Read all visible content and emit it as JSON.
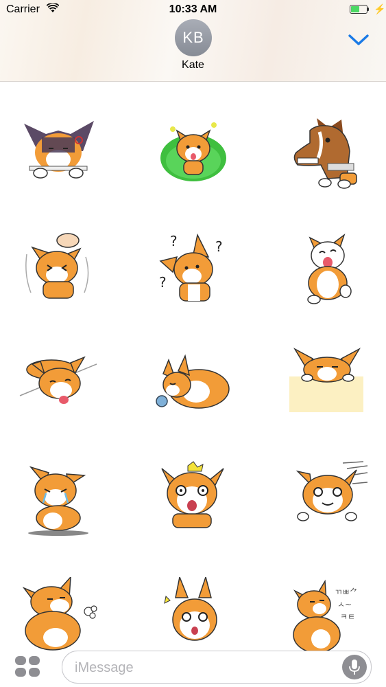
{
  "status_bar": {
    "carrier": "Carrier",
    "time": "10:33 AM",
    "battery_level": 0.55
  },
  "header": {
    "avatar_initials": "KB",
    "contact_name": "Kate",
    "chevron_icon": "chevron-down-icon"
  },
  "stickers": [
    {
      "name": "sticker-corgi-gloomy"
    },
    {
      "name": "sticker-corgi-in-grass"
    },
    {
      "name": "sticker-corgi-horse-mask"
    },
    {
      "name": "sticker-corgi-head-pat"
    },
    {
      "name": "sticker-corgi-confused"
    },
    {
      "name": "sticker-corgi-laughing"
    },
    {
      "name": "sticker-corgi-lying-tongue-out"
    },
    {
      "name": "sticker-corgi-sleeping"
    },
    {
      "name": "sticker-corgi-peeking-over-sign"
    },
    {
      "name": "sticker-corgi-crying"
    },
    {
      "name": "sticker-corgi-shocked"
    },
    {
      "name": "sticker-corgi-dashing"
    },
    {
      "name": "sticker-corgi-huffing"
    },
    {
      "name": "sticker-corgi-surprised"
    },
    {
      "name": "sticker-corgi-grumbling"
    }
  ],
  "input": {
    "placeholder": "iMessage",
    "value": ""
  },
  "colors": {
    "accent": "#1a7ae6",
    "corgi_orange": "#f29c38",
    "icon_gray": "#8e8e93"
  }
}
